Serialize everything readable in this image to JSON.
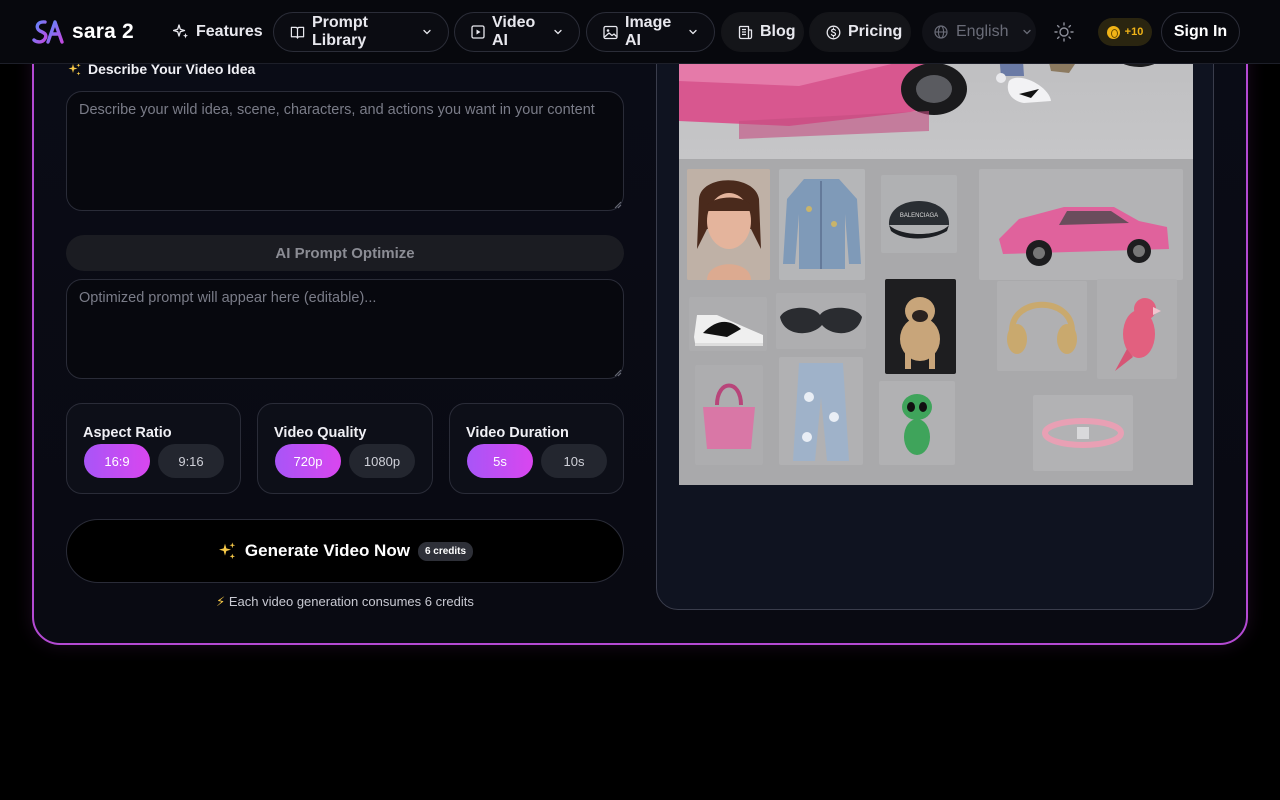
{
  "brand": {
    "name": "sara 2"
  },
  "nav": {
    "features": "Features",
    "prompt_library": "Prompt Library",
    "video_ai": "Video AI",
    "image_ai": "Image AI",
    "blog": "Blog",
    "pricing": "Pricing",
    "language": "English",
    "credits": "+10",
    "sign_in": "Sign In"
  },
  "form": {
    "idea_label": "Describe Your Video Idea",
    "idea_placeholder": "Describe your wild idea, scene, characters, and actions you want in your content",
    "optimize_label": "AI Prompt Optimize",
    "optimized_placeholder": "Optimized prompt will appear here (editable)...",
    "aspect_ratio": {
      "title": "Aspect Ratio",
      "options": [
        "16:9",
        "9:16"
      ],
      "selected": "16:9"
    },
    "video_quality": {
      "title": "Video Quality",
      "options": [
        "720p",
        "1080p"
      ],
      "selected": "720p"
    },
    "video_duration": {
      "title": "Video Duration",
      "options": [
        "5s",
        "10s"
      ],
      "selected": "5s"
    },
    "generate_label": "Generate Video Now",
    "generate_badge": "6 credits",
    "note": "Each video generation consumes 6 credits"
  },
  "colors": {
    "accent": "#b44ad3",
    "chip_active_start": "#a855f7",
    "chip_active_end": "#d946ef",
    "coin": "#f1b417",
    "car_pink": "#e8569a"
  }
}
